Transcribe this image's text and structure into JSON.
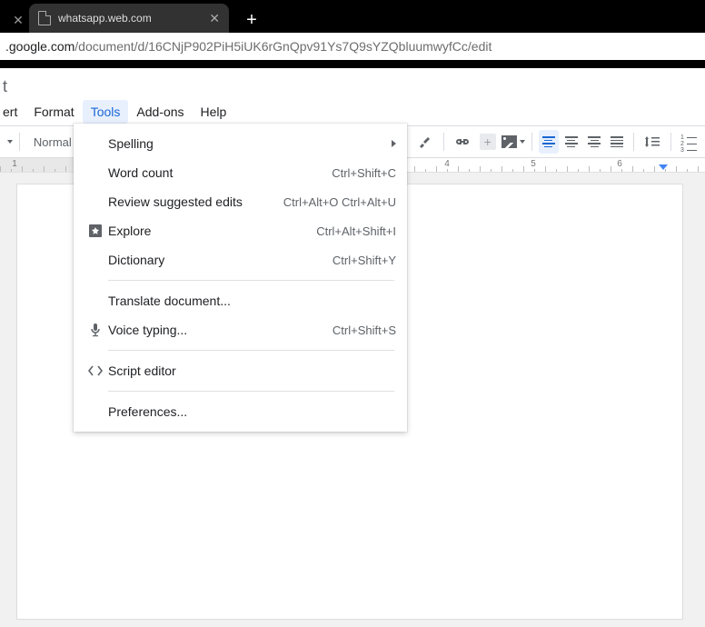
{
  "browser": {
    "tab_title": "whatsapp.web.com",
    "url_prefix": ".google.com",
    "url_rest": "/document/d/16CNjP902PiH5iUK6rGnQpv91Ys7Q9sYZQbluumwyfCc/edit"
  },
  "doc_title_partial": "t",
  "menubar": {
    "items": [
      "ert",
      "Format",
      "Tools",
      "Add-ons",
      "Help"
    ],
    "active_index": 2
  },
  "toolbar": {
    "style_text": "Normal"
  },
  "ruler": {
    "numbers": [
      1,
      4,
      5,
      6
    ]
  },
  "tools_menu": {
    "items": [
      {
        "label": "Spelling",
        "submenu": true
      },
      {
        "label": "Word count",
        "shortcut": "Ctrl+Shift+C"
      },
      {
        "label": "Review suggested edits",
        "shortcut": "Ctrl+Alt+O Ctrl+Alt+U"
      },
      {
        "label": "Explore",
        "shortcut": "Ctrl+Alt+Shift+I",
        "icon": "explore"
      },
      {
        "label": "Dictionary",
        "shortcut": "Ctrl+Shift+Y"
      },
      {
        "sep": true
      },
      {
        "label": "Translate document..."
      },
      {
        "label": "Voice typing...",
        "shortcut": "Ctrl+Shift+S",
        "icon": "mic",
        "highlight": true
      },
      {
        "sep": true
      },
      {
        "label": "Script editor",
        "icon": "script"
      },
      {
        "sep": true
      },
      {
        "label": "Preferences..."
      }
    ]
  }
}
